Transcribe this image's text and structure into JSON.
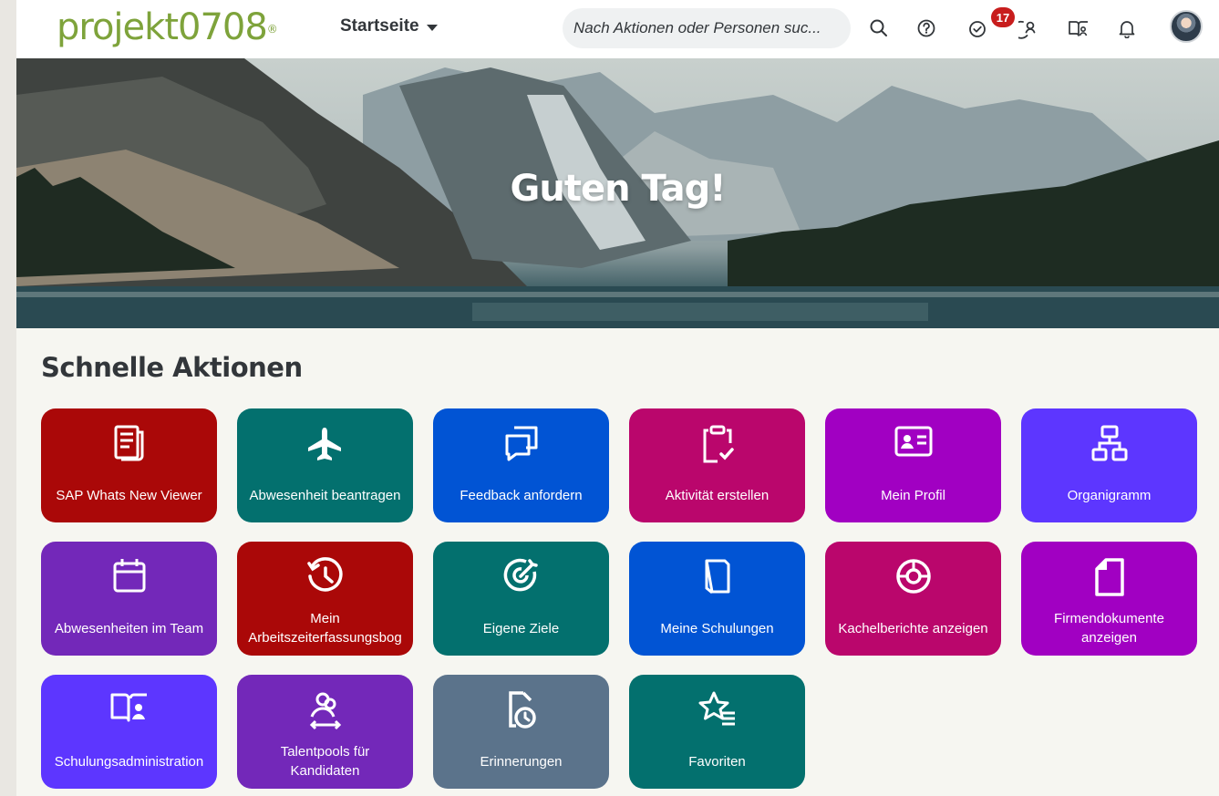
{
  "header": {
    "logo_text": "projekt0708",
    "logo_mark": "®",
    "nav_label": "Startseite",
    "search_placeholder": "Nach Aktionen oder Personen suc...",
    "todo_badge": "17"
  },
  "hero": {
    "greeting": "Guten Tag!"
  },
  "quick_actions": {
    "title": "Schnelle Aktionen",
    "tiles": [
      {
        "label": "SAP Whats New Viewer",
        "icon": "document-list-icon",
        "color": "#aa0808"
      },
      {
        "label": "Abwesenheit beantragen",
        "icon": "airplane-icon",
        "color": "#03706e"
      },
      {
        "label": "Feedback anfordern",
        "icon": "feedback-icon",
        "color": "#0154d4"
      },
      {
        "label": "Aktivität erstellen",
        "icon": "clipboard-check-icon",
        "color": "#ba066c"
      },
      {
        "label": "Mein Profil",
        "icon": "profile-card-icon",
        "color": "#a100c2"
      },
      {
        "label": "Organigramm",
        "icon": "org-chart-icon",
        "color": "#5d36ff"
      },
      {
        "label": "Abwesenheiten im Team",
        "icon": "calendar-icon",
        "color": "#7328b9"
      },
      {
        "label": "Mein Arbeitszeiterfassungsbogen",
        "label_line1": "Mein",
        "label_line2": "Arbeitszeiterfassungsbog",
        "icon": "history-icon",
        "color": "#aa0808"
      },
      {
        "label": "Eigene Ziele",
        "icon": "target-icon",
        "color": "#03706e"
      },
      {
        "label": "Meine Schulungen",
        "icon": "book-icon",
        "color": "#0154d4"
      },
      {
        "label": "Kachelberichte anzeigen",
        "icon": "donut-report-icon",
        "color": "#ba066c"
      },
      {
        "label": "Firmendokumente anzeigen",
        "label_line1": "Firmendokumente",
        "label_line2": "anzeigen",
        "icon": "document-icon",
        "color": "#a100c2"
      },
      {
        "label": "Schulungsadministration",
        "icon": "learning-admin-icon",
        "color": "#5d36ff"
      },
      {
        "label": "Talentpools für Kandidaten",
        "label_line1": "Talentpools für",
        "label_line2": "Kandidaten",
        "icon": "talent-pool-icon",
        "color": "#7328b9"
      },
      {
        "label": "Erinnerungen",
        "icon": "reminder-icon",
        "color": "#5b738b"
      },
      {
        "label": "Favoriten",
        "icon": "star-list-icon",
        "color": "#03706e"
      }
    ]
  }
}
